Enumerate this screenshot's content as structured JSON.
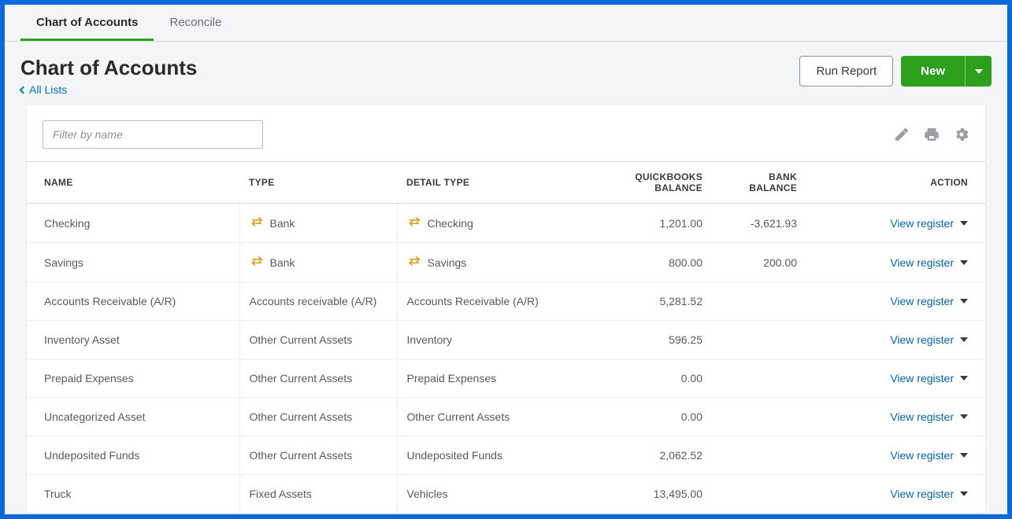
{
  "tabs": [
    {
      "label": "Chart of Accounts",
      "active": true
    },
    {
      "label": "Reconcile",
      "active": false
    }
  ],
  "page": {
    "title": "Chart of Accounts",
    "breadcrumb": "All Lists",
    "run_report": "Run Report",
    "new": "New"
  },
  "filter": {
    "placeholder": "Filter by name"
  },
  "columns": {
    "name": "NAME",
    "type": "TYPE",
    "detail": "DETAIL TYPE",
    "qb_balance": "QUICKBOOKS BALANCE",
    "bank_balance": "BANK BALANCE",
    "action": "ACTION"
  },
  "action_label": "View register",
  "rows": [
    {
      "name": "Checking",
      "type": "Bank",
      "detail": "Checking",
      "qb": "1,201.00",
      "bank": "-3,621.93",
      "has_icon": true
    },
    {
      "name": "Savings",
      "type": "Bank",
      "detail": "Savings",
      "qb": "800.00",
      "bank": "200.00",
      "has_icon": true
    },
    {
      "name": "Accounts Receivable (A/R)",
      "type": "Accounts receivable (A/R)",
      "detail": "Accounts Receivable (A/R)",
      "qb": "5,281.52",
      "bank": "",
      "has_icon": false
    },
    {
      "name": "Inventory Asset",
      "type": "Other Current Assets",
      "detail": "Inventory",
      "qb": "596.25",
      "bank": "",
      "has_icon": false
    },
    {
      "name": "Prepaid Expenses",
      "type": "Other Current Assets",
      "detail": "Prepaid Expenses",
      "qb": "0.00",
      "bank": "",
      "has_icon": false
    },
    {
      "name": "Uncategorized Asset",
      "type": "Other Current Assets",
      "detail": "Other Current Assets",
      "qb": "0.00",
      "bank": "",
      "has_icon": false
    },
    {
      "name": "Undeposited Funds",
      "type": "Other Current Assets",
      "detail": "Undeposited Funds",
      "qb": "2,062.52",
      "bank": "",
      "has_icon": false
    },
    {
      "name": "Truck",
      "type": "Fixed Assets",
      "detail": "Vehicles",
      "qb": "13,495.00",
      "bank": "",
      "has_icon": false
    }
  ]
}
